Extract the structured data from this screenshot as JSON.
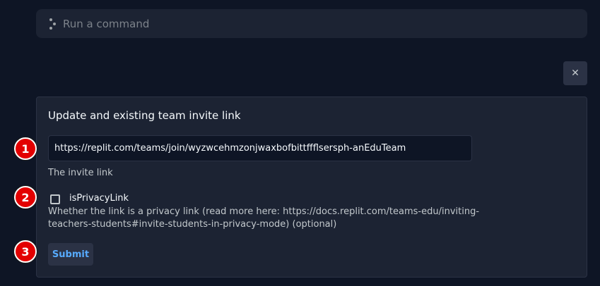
{
  "command_bar": {
    "placeholder": "Run a command",
    "icon": "command-dots-icon"
  },
  "close_button": {
    "icon": "close-icon",
    "glyph": "✕"
  },
  "form": {
    "title": "Update and existing team invite link",
    "link_field": {
      "value": "https://replit.com/teams/join/wyzwcehmzonjwaxbofbittffflsersph-anEduTeam",
      "help": "The invite link"
    },
    "privacy_field": {
      "label": "isPrivacyLink",
      "checked": false,
      "help": "Whether the link is a privacy link (read more here: https://docs.replit.com/teams-edu/inviting-teachers-students#invite-students-in-privacy-mode) (optional)"
    },
    "submit_label": "Submit"
  },
  "markers": [
    "1",
    "2",
    "3"
  ],
  "colors": {
    "background": "#0e1525",
    "surface": "#1c2333",
    "accent": "#57abff",
    "marker": "#e30000"
  }
}
